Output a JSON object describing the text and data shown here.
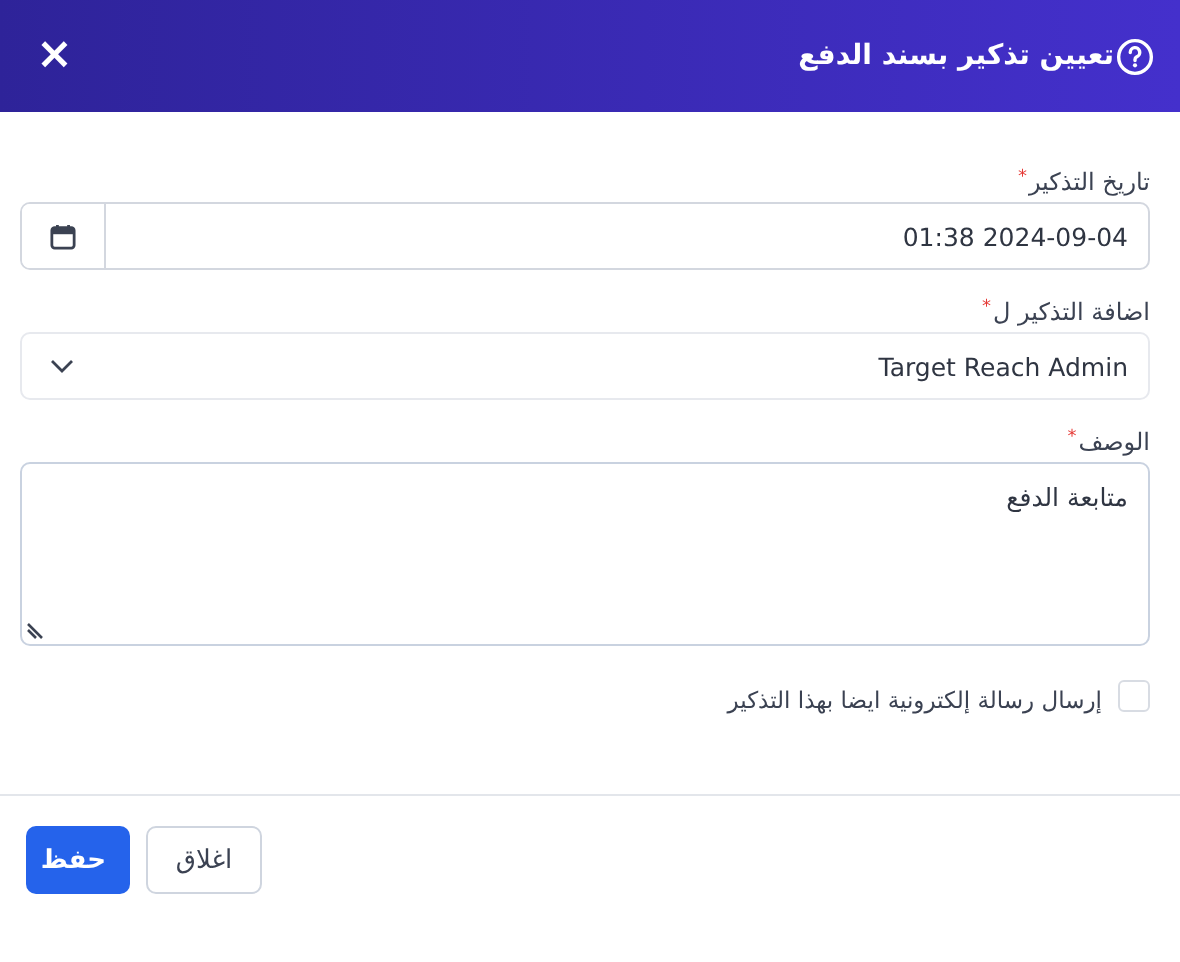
{
  "dialog": {
    "title": "تعيين تذكير بسند الدفع",
    "close": "×"
  },
  "fields": [
    {
      "kind": "datetime",
      "label": "تاريخ التذكير",
      "required_mark": "*",
      "value": "2024-09-04 01:38"
    },
    {
      "kind": "select",
      "label": "اضافة التذكير ل",
      "required_mark": "*",
      "value": "Target Reach Admin"
    },
    {
      "kind": "textarea",
      "label": "الوصف",
      "required_mark": "*",
      "value": "متابعة الدفع"
    },
    {
      "kind": "checkbox",
      "label": "إرسال رسالة إلكترونية ايضا بهذا التذكير",
      "checked": false
    }
  ],
  "buttons": [
    {
      "kind": "secondary",
      "label": "اغلاق"
    },
    {
      "kind": "primary",
      "label": "حفظ"
    }
  ]
}
